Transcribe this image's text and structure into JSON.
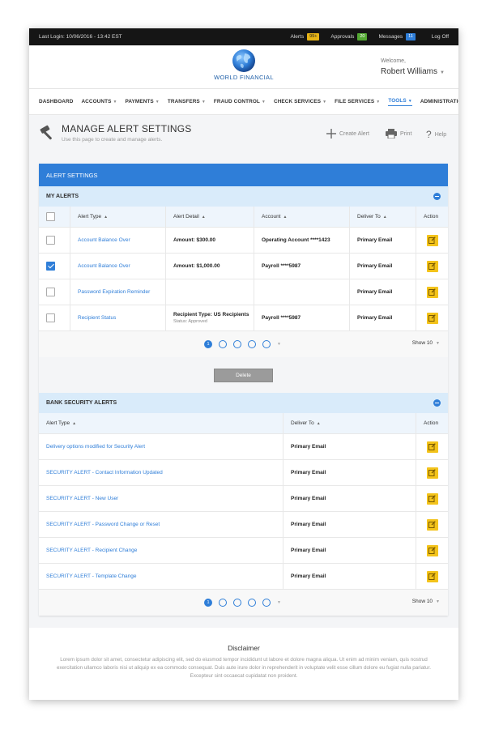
{
  "topbar": {
    "last_login": "Last Login: 10/06/2016 - 13:42 EST",
    "alerts_label": "Alerts",
    "alerts_count": "99+",
    "approvals_label": "Approvals",
    "approvals_count": "20",
    "messages_label": "Messages",
    "messages_count": "11",
    "logoff": "Log Off"
  },
  "header": {
    "brand": "WORLD FINANCIAL",
    "welcome": "Welcome,",
    "user": "Robert Williams"
  },
  "nav": [
    {
      "label": "DASHBOARD",
      "dropdown": false
    },
    {
      "label": "ACCOUNTS",
      "dropdown": true
    },
    {
      "label": "PAYMENTS",
      "dropdown": true
    },
    {
      "label": "TRANSFERS",
      "dropdown": true
    },
    {
      "label": "FRAUD CONTROL",
      "dropdown": true
    },
    {
      "label": "CHECK SERVICES",
      "dropdown": true
    },
    {
      "label": "FILE SERVICES",
      "dropdown": true
    },
    {
      "label": "TOOLS",
      "dropdown": true,
      "active": true
    },
    {
      "label": "ADMINISTRATION",
      "dropdown": true
    }
  ],
  "page": {
    "title": "MANAGE ALERT SETTINGS",
    "subtitle": "Use this page to create and manage alerts.",
    "create_alert": "Create Alert",
    "print": "Print",
    "help": "Help"
  },
  "alert_settings": {
    "title": "ALERT SETTINGS",
    "my_alerts": {
      "title": "MY ALERTS",
      "headers": {
        "type": "Alert Type",
        "detail": "Alert Detail",
        "account": "Account",
        "deliver": "Deliver To",
        "action": "Action"
      },
      "rows": [
        {
          "checked": false,
          "type": "Account Balance Over",
          "detail": "Amount: $300.00",
          "detail_sub": "",
          "account": "Operating  Account ****1423",
          "deliver": "Primary Email"
        },
        {
          "checked": true,
          "type": "Account Balance Over",
          "detail": "Amount: $1,000.00",
          "detail_sub": "",
          "account": "Payroll ****5987",
          "deliver": "Primary Email"
        },
        {
          "checked": false,
          "type": "Password Expiration Reminder",
          "detail": "",
          "detail_sub": "",
          "account": "",
          "deliver": "Primary Email"
        },
        {
          "checked": false,
          "type": "Recipient Status",
          "detail": "Recipient Type: US Recipients",
          "detail_sub": "Status: Approved",
          "account": "Payroll ****5987",
          "deliver": "Primary Email"
        }
      ],
      "pager": {
        "current": "1",
        "show": "Show 10"
      },
      "delete_label": "Delete"
    },
    "bank_alerts": {
      "title": "BANK SECURITY ALERTS",
      "headers": {
        "type": "Alert Type",
        "deliver": "Deliver To",
        "action": "Action"
      },
      "rows": [
        {
          "type": "Delivery options modified for Security Alert",
          "deliver": "Primary Email"
        },
        {
          "type": "SECURITY ALERT - Contact Information Updated",
          "deliver": "Primary Email"
        },
        {
          "type": "SECURITY ALERT - New User",
          "deliver": "Primary Email"
        },
        {
          "type": "SECURITY ALERT - Password Change or Reset",
          "deliver": "Primary Email"
        },
        {
          "type": "SECURITY ALERT - Recipient Change",
          "deliver": "Primary Email"
        },
        {
          "type": "SECURITY ALERT - Template Change",
          "deliver": "Primary Email"
        }
      ],
      "pager": {
        "current": "1",
        "show": "Show 10"
      }
    }
  },
  "disclaimer": {
    "title": "Disclaimer",
    "text": "Lorem ipsum dolor sit amet, consectetur adipiscing elit, sed do eiusmod tempor incididunt ut labore et dolore magna aliqua. Ut enim ad minim veniam, quis nostrud exercitation ullamco laboris nisi ut aliquip ex ea commodo consequat. Duis aute irure dolor in reprehenderit in voluptate velit esse cillum dolore eu fugiat nulla pariatur. Excepteur sint occaecat cupidatat non proident."
  },
  "colors": {
    "accent": "#2f7ed8",
    "edit": "#f3c31b",
    "topbar": "#151515"
  }
}
